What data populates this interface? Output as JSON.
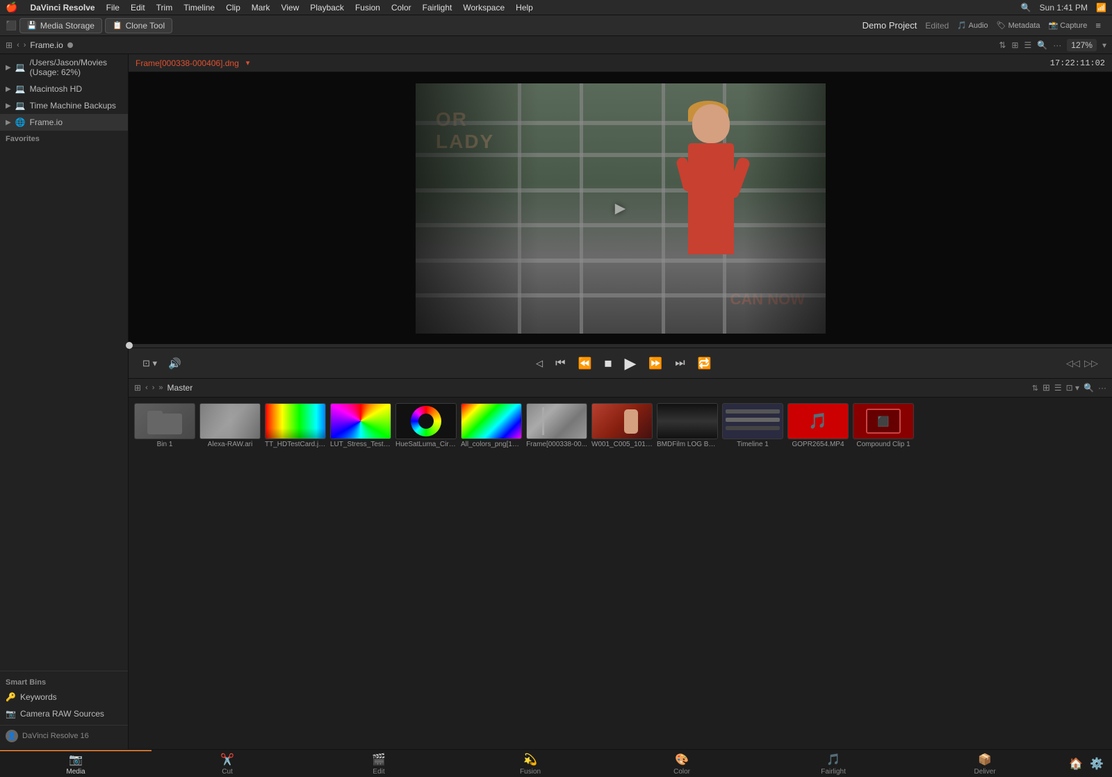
{
  "menubar": {
    "apple": "🍎",
    "app": "DaVinci Resolve",
    "menus": [
      "File",
      "Edit",
      "Trim",
      "Timeline",
      "Clip",
      "Mark",
      "View",
      "Playback",
      "Fusion",
      "Color",
      "Fairlight",
      "Workspace",
      "Help"
    ],
    "right": {
      "time": "Sun 1:41 PM",
      "icons": [
        "search",
        "wifi",
        "battery",
        "control-center"
      ]
    }
  },
  "tabs": [
    {
      "icon": "💾",
      "label": "Media Storage"
    },
    {
      "icon": "📋",
      "label": "Clone Tool"
    }
  ],
  "breadcrumb": {
    "text": "Frame.io",
    "zoom": "127%"
  },
  "left_sidebar": {
    "items": [
      {
        "label": "/Users/Jason/Movies (Usage: 62%)",
        "type": "drive"
      },
      {
        "label": "Macintosh HD",
        "type": "drive"
      },
      {
        "label": "Time Machine Backups",
        "type": "drive"
      },
      {
        "label": "Frame.io",
        "type": "frameio",
        "selected": true
      }
    ],
    "favorites_label": "Favorites",
    "smart_bins_label": "Smart Bins",
    "smart_bins": [
      {
        "label": "Keywords"
      },
      {
        "label": "Camera RAW Sources"
      }
    ]
  },
  "preview": {
    "filename": "Frame[000338-000406].dng",
    "timecode": "17:22:11:02",
    "transport": {
      "rewind_to_start": "⏮",
      "step_back": "◀",
      "stop": "⏹",
      "play": "▶",
      "step_forward": "▶▶",
      "loop": "🔁"
    }
  },
  "media_browser": {
    "bin_label": "Master",
    "nav_label": "Master",
    "items": [
      {
        "id": "bin1",
        "label": "Bin 1",
        "type": "folder"
      },
      {
        "id": "alexa",
        "label": "Alexa-RAW.ari",
        "type": "alexa"
      },
      {
        "id": "testcard",
        "label": "TT_HDTestCard.jpg",
        "type": "testcard"
      },
      {
        "id": "lut",
        "label": "LUT_Stress_Test_...",
        "type": "lut"
      },
      {
        "id": "huesat",
        "label": "HueSatLuma_Circl...",
        "type": "huesat"
      },
      {
        "id": "allcolors",
        "label": "All_colors_png[16-...",
        "type": "allcolors"
      },
      {
        "id": "frame338",
        "label": "Frame[000338-00...",
        "type": "frame"
      },
      {
        "id": "w001",
        "label": "W001_C005_1014...",
        "type": "w001"
      },
      {
        "id": "bmdfilm",
        "label": "BMDFilm LOG BM...",
        "type": "bmdfilm"
      },
      {
        "id": "timeline1",
        "label": "Timeline 1",
        "type": "timeline"
      },
      {
        "id": "gopro",
        "label": "GOPR2654.MP4",
        "type": "gopro"
      },
      {
        "id": "compound",
        "label": "Compound Clip 1",
        "type": "compound"
      }
    ]
  },
  "bottom_nav": {
    "items": [
      {
        "id": "media",
        "label": "Media",
        "icon": "📷",
        "active": true
      },
      {
        "id": "cut",
        "label": "Cut",
        "icon": "✂️",
        "active": false
      },
      {
        "id": "edit",
        "label": "Edit",
        "icon": "🎬",
        "active": false
      },
      {
        "id": "fusion",
        "label": "Fusion",
        "icon": "💫",
        "active": false
      },
      {
        "id": "color",
        "label": "Color",
        "icon": "🎨",
        "active": false
      },
      {
        "id": "fairlight",
        "label": "Fairlight",
        "icon": "🎵",
        "active": false
      },
      {
        "id": "deliver",
        "label": "Deliver",
        "icon": "📦",
        "active": false
      }
    ]
  },
  "project": {
    "name": "Demo Project",
    "status": "Edited"
  },
  "footer": {
    "app_name": "DaVinci Resolve 16"
  }
}
